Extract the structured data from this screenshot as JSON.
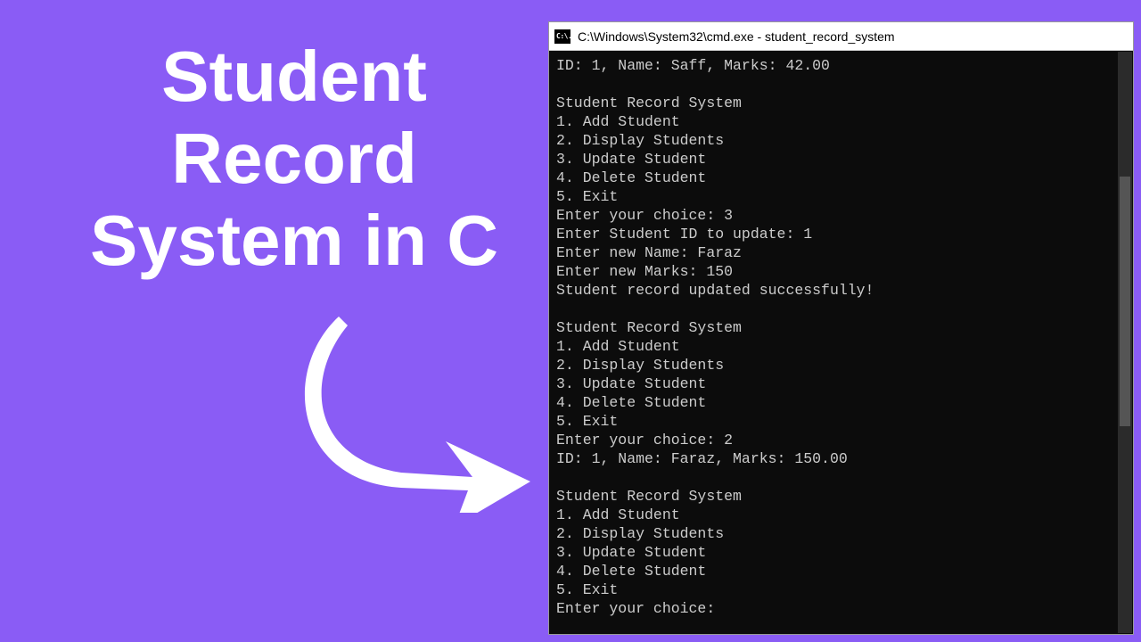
{
  "heading": "Student Record System in C",
  "cmd": {
    "icon_label": "C:\\.",
    "title": "C:\\Windows\\System32\\cmd.exe - student_record_system",
    "lines": [
      "ID: 1, Name: Saff, Marks: 42.00",
      "",
      "Student Record System",
      "1. Add Student",
      "2. Display Students",
      "3. Update Student",
      "4. Delete Student",
      "5. Exit",
      "Enter your choice: 3",
      "Enter Student ID to update: 1",
      "Enter new Name: Faraz",
      "Enter new Marks: 150",
      "Student record updated successfully!",
      "",
      "Student Record System",
      "1. Add Student",
      "2. Display Students",
      "3. Update Student",
      "4. Delete Student",
      "5. Exit",
      "Enter your choice: 2",
      "ID: 1, Name: Faraz, Marks: 150.00",
      "",
      "Student Record System",
      "1. Add Student",
      "2. Display Students",
      "3. Update Student",
      "4. Delete Student",
      "5. Exit",
      "Enter your choice:"
    ]
  }
}
